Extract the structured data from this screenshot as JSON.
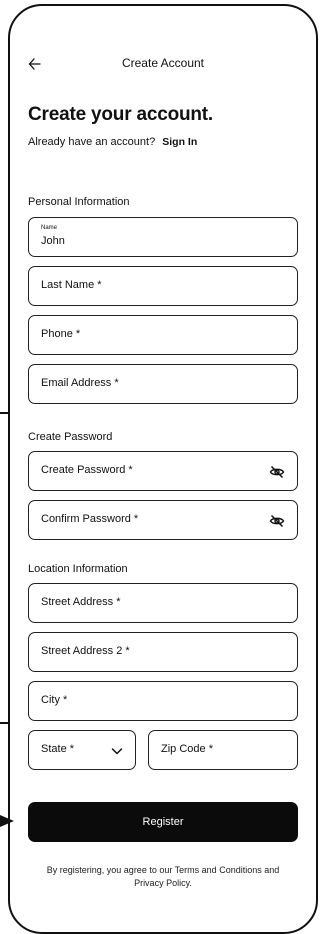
{
  "header": {
    "title": "Create Account"
  },
  "page": {
    "heading": "Create your account.",
    "have_account_text": "Already have an account?",
    "sign_in_link": "Sign In"
  },
  "personal": {
    "section_title": "Personal Information",
    "name_label": "Name",
    "name_value": "John",
    "last_name_placeholder": "Last Name *",
    "phone_placeholder": "Phone *",
    "email_placeholder": "Email Address *"
  },
  "password": {
    "section_title": "Create Password",
    "create_placeholder": "Create Password *",
    "confirm_placeholder": "Confirm Password *"
  },
  "location": {
    "section_title": "Location Information",
    "street_placeholder": "Street Address *",
    "street2_placeholder": "Street Address 2 *",
    "city_placeholder": "City *",
    "state_placeholder": "State *",
    "zip_placeholder": "Zip Code *"
  },
  "actions": {
    "register_label": "Register"
  },
  "footer": {
    "terms_text": "By registering, you agree to our Terms and Conditions and Privacy Policy."
  },
  "icons": {
    "back": "arrow-left-icon",
    "eye_off": "eye-off-icon",
    "chevron": "chevron-down-icon"
  }
}
